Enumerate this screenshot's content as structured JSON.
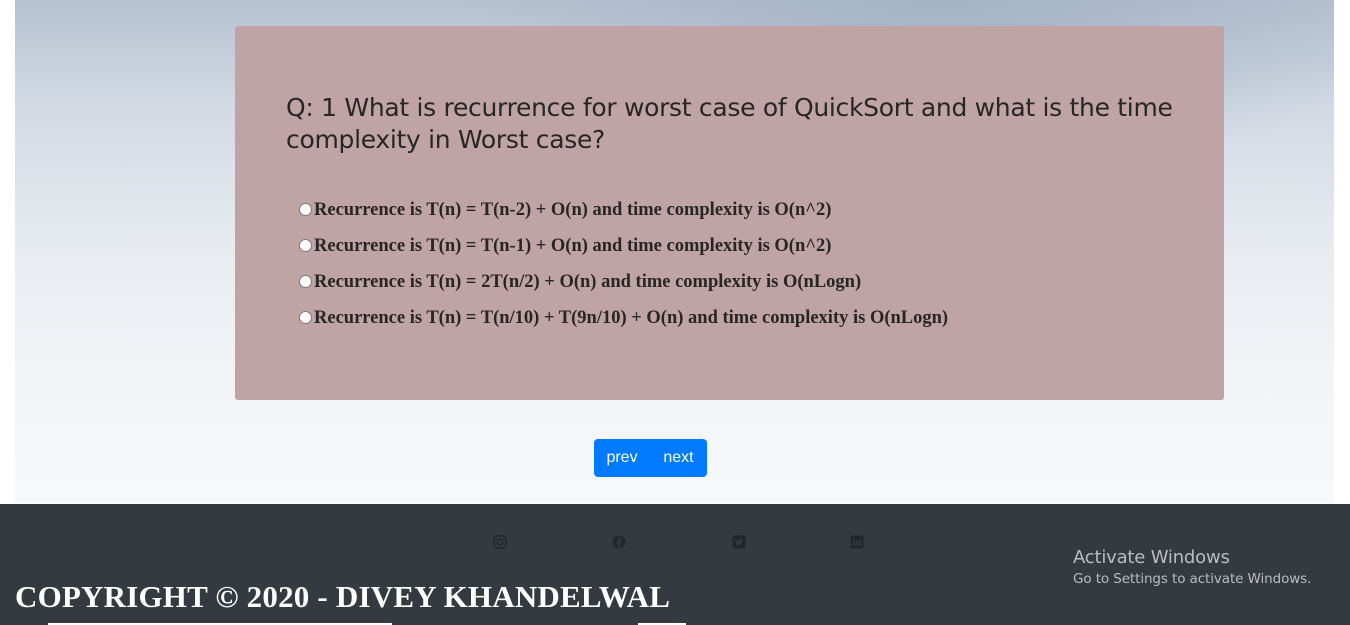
{
  "question": {
    "text": "Q: 1 What is recurrence for worst case of QuickSort and what is the time complexity in Worst case?",
    "options": [
      "Recurrence is T(n) = T(n-2) + O(n) and time complexity is O(n^2)",
      "Recurrence is T(n) = T(n-1) + O(n) and time complexity is O(n^2)",
      "Recurrence is T(n) = 2T(n/2) + O(n) and time complexity is O(nLogn)",
      "Recurrence is T(n) = T(n/10) + T(9n/10) + O(n) and time complexity is O(nLogn)"
    ]
  },
  "pager": {
    "prev_label": "prev",
    "next_label": "next"
  },
  "footer": {
    "social_icons": [
      "instagram-icon",
      "facebook-icon",
      "twitter-icon",
      "linkedin-icon"
    ],
    "copyright": "COPYRIGHT © 2020 - DIVEY KHANDELWAL"
  },
  "overlay": {
    "activate_title": "Activate Windows",
    "activate_subtitle": "Go to Settings to activate Windows."
  },
  "colors": {
    "card": "#c0a3a4",
    "button": "#007bff",
    "footer": "#343a40"
  }
}
